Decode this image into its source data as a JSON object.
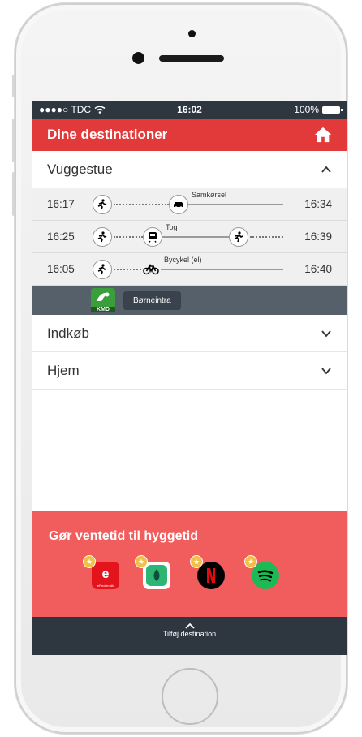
{
  "status_bar": {
    "carrier": "●●●●○ TDC",
    "time": "16:02",
    "battery": "100%"
  },
  "header": {
    "title": "Dine destinationer",
    "home_icon": "home-icon"
  },
  "sections": [
    {
      "name": "Vuggestue",
      "expanded": true
    },
    {
      "name": "Indkøb",
      "expanded": false
    },
    {
      "name": "Hjem",
      "expanded": false
    }
  ],
  "routes": [
    {
      "start": "16:17",
      "end": "16:34",
      "label": "Samkørsel"
    },
    {
      "start": "16:25",
      "end": "16:39",
      "label": "Tog"
    },
    {
      "start": "16:05",
      "end": "16:40",
      "label": "Bycykel (el)"
    }
  ],
  "app_strip": {
    "app_label": "Børneintra",
    "icon_text": "KMD"
  },
  "promo": {
    "title": "Gør ventetid til hyggetid",
    "apps": [
      {
        "name": "eReolen",
        "badge": "★",
        "caption": "eReolen.dk",
        "color": "#e3141b"
      },
      {
        "name": "Mofibo",
        "badge": "★",
        "color": "#ffffff"
      },
      {
        "name": "Netflix",
        "badge": "★",
        "color": "#000000"
      },
      {
        "name": "Spotify",
        "badge": "★",
        "color": "#1db954"
      }
    ]
  },
  "bottom": {
    "label": "Tilføj destination"
  },
  "colors": {
    "accent": "#e23a3a",
    "dark": "#2e3640",
    "promo": "#f15c5c"
  }
}
